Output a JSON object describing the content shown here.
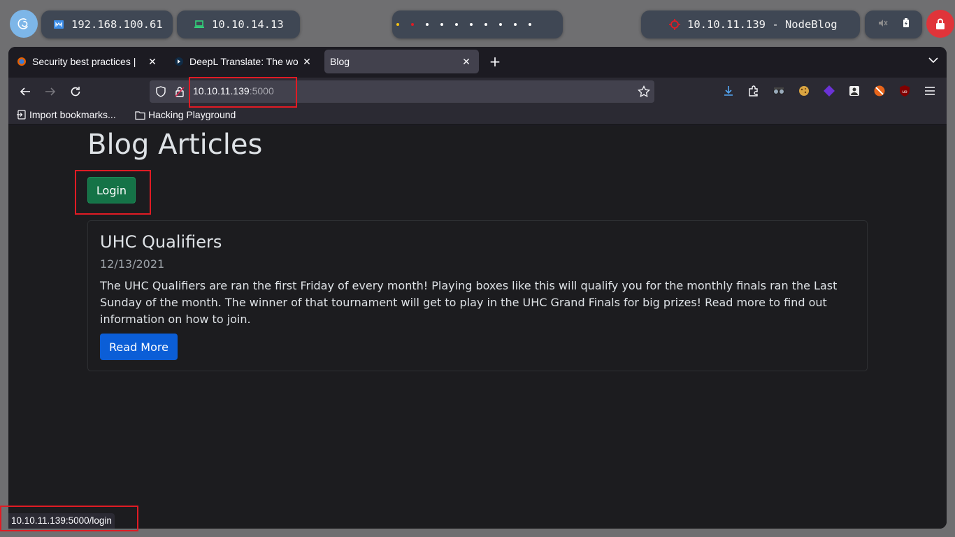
{
  "system_bar": {
    "target_ip": "192.168.100.61",
    "vpn_ip": "10.10.14.13",
    "machine_label": "10.10.11.139 - NodeBlog",
    "workspace_dot_colors": [
      "#f5c211",
      "#e01b24",
      "#ffffff",
      "#ffffff",
      "#ffffff",
      "#ffffff",
      "#ffffff",
      "#ffffff",
      "#ffffff",
      "#ffffff"
    ]
  },
  "browser": {
    "tabs": [
      {
        "title": "Security best practices |",
        "active": false
      },
      {
        "title": "DeepL Translate: The wo",
        "active": false
      },
      {
        "title": "Blog",
        "active": true
      }
    ],
    "url_host": "10.10.11.139",
    "url_port": ":5000",
    "bookmarks": [
      {
        "label": "Import bookmarks...",
        "icon": "import-icon"
      },
      {
        "label": "Hacking Playground",
        "icon": "folder-icon"
      }
    ],
    "status_url": "10.10.11.139:5000/login"
  },
  "page": {
    "heading": "Blog Articles",
    "login_label": "Login",
    "articles": [
      {
        "title": "UHC Qualifiers",
        "date": "12/13/2021",
        "body": "The UHC Qualifiers are ran the first Friday of every month! Playing boxes like this will qualify you for the monthly finals ran the Last Sunday of the month. The winner of that tournament will get to play in the UHC Grand Finals for big prizes! Read more to find out information on how to join.",
        "button": "Read More"
      }
    ]
  },
  "colors": {
    "login_button": "#157347",
    "read_more_button": "#0b5ed7",
    "annotation": "#e01b24",
    "lock_button": "#e0343a"
  }
}
